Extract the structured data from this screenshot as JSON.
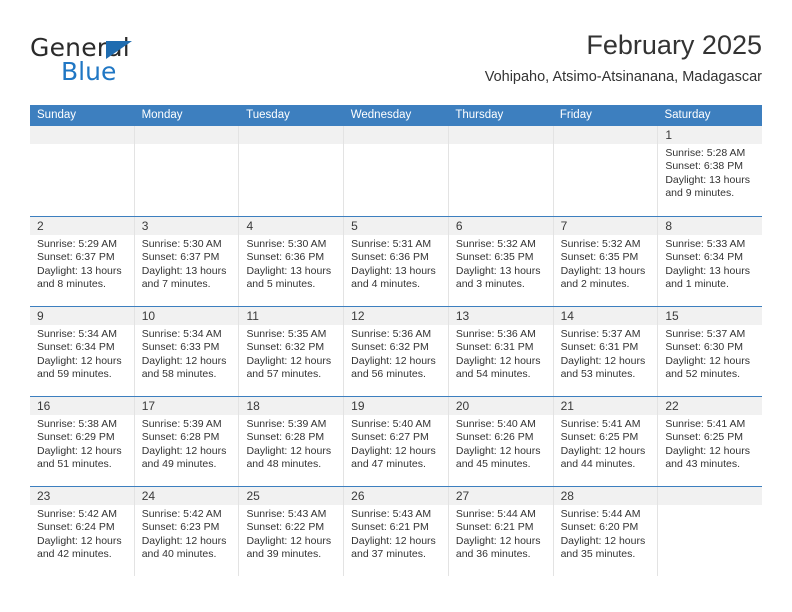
{
  "logo": {
    "word_top": "General",
    "word_bottom": "Blue",
    "triangle_color": "#1f6cb0",
    "blue_color": "#2077c4"
  },
  "header": {
    "title": "February 2025",
    "subtitle": "Vohipaho, Atsimo-Atsinanana, Madagascar"
  },
  "theme": {
    "header_bar": "#3d7fbf",
    "daynum_strip": "#f1f1f1",
    "row_divider": "#3d7fbf",
    "cell_divider": "#e3e3e3"
  },
  "weekdays": [
    "Sunday",
    "Monday",
    "Tuesday",
    "Wednesday",
    "Thursday",
    "Friday",
    "Saturday"
  ],
  "weeks": [
    [
      {
        "day": ""
      },
      {
        "day": ""
      },
      {
        "day": ""
      },
      {
        "day": ""
      },
      {
        "day": ""
      },
      {
        "day": ""
      },
      {
        "day": "1",
        "sunrise": "Sunrise: 5:28 AM",
        "sunset": "Sunset: 6:38 PM",
        "daylight": "Daylight: 13 hours and 9 minutes."
      }
    ],
    [
      {
        "day": "2",
        "sunrise": "Sunrise: 5:29 AM",
        "sunset": "Sunset: 6:37 PM",
        "daylight": "Daylight: 13 hours and 8 minutes."
      },
      {
        "day": "3",
        "sunrise": "Sunrise: 5:30 AM",
        "sunset": "Sunset: 6:37 PM",
        "daylight": "Daylight: 13 hours and 7 minutes."
      },
      {
        "day": "4",
        "sunrise": "Sunrise: 5:30 AM",
        "sunset": "Sunset: 6:36 PM",
        "daylight": "Daylight: 13 hours and 5 minutes."
      },
      {
        "day": "5",
        "sunrise": "Sunrise: 5:31 AM",
        "sunset": "Sunset: 6:36 PM",
        "daylight": "Daylight: 13 hours and 4 minutes."
      },
      {
        "day": "6",
        "sunrise": "Sunrise: 5:32 AM",
        "sunset": "Sunset: 6:35 PM",
        "daylight": "Daylight: 13 hours and 3 minutes."
      },
      {
        "day": "7",
        "sunrise": "Sunrise: 5:32 AM",
        "sunset": "Sunset: 6:35 PM",
        "daylight": "Daylight: 13 hours and 2 minutes."
      },
      {
        "day": "8",
        "sunrise": "Sunrise: 5:33 AM",
        "sunset": "Sunset: 6:34 PM",
        "daylight": "Daylight: 13 hours and 1 minute."
      }
    ],
    [
      {
        "day": "9",
        "sunrise": "Sunrise: 5:34 AM",
        "sunset": "Sunset: 6:34 PM",
        "daylight": "Daylight: 12 hours and 59 minutes."
      },
      {
        "day": "10",
        "sunrise": "Sunrise: 5:34 AM",
        "sunset": "Sunset: 6:33 PM",
        "daylight": "Daylight: 12 hours and 58 minutes."
      },
      {
        "day": "11",
        "sunrise": "Sunrise: 5:35 AM",
        "sunset": "Sunset: 6:32 PM",
        "daylight": "Daylight: 12 hours and 57 minutes."
      },
      {
        "day": "12",
        "sunrise": "Sunrise: 5:36 AM",
        "sunset": "Sunset: 6:32 PM",
        "daylight": "Daylight: 12 hours and 56 minutes."
      },
      {
        "day": "13",
        "sunrise": "Sunrise: 5:36 AM",
        "sunset": "Sunset: 6:31 PM",
        "daylight": "Daylight: 12 hours and 54 minutes."
      },
      {
        "day": "14",
        "sunrise": "Sunrise: 5:37 AM",
        "sunset": "Sunset: 6:31 PM",
        "daylight": "Daylight: 12 hours and 53 minutes."
      },
      {
        "day": "15",
        "sunrise": "Sunrise: 5:37 AM",
        "sunset": "Sunset: 6:30 PM",
        "daylight": "Daylight: 12 hours and 52 minutes."
      }
    ],
    [
      {
        "day": "16",
        "sunrise": "Sunrise: 5:38 AM",
        "sunset": "Sunset: 6:29 PM",
        "daylight": "Daylight: 12 hours and 51 minutes."
      },
      {
        "day": "17",
        "sunrise": "Sunrise: 5:39 AM",
        "sunset": "Sunset: 6:28 PM",
        "daylight": "Daylight: 12 hours and 49 minutes."
      },
      {
        "day": "18",
        "sunrise": "Sunrise: 5:39 AM",
        "sunset": "Sunset: 6:28 PM",
        "daylight": "Daylight: 12 hours and 48 minutes."
      },
      {
        "day": "19",
        "sunrise": "Sunrise: 5:40 AM",
        "sunset": "Sunset: 6:27 PM",
        "daylight": "Daylight: 12 hours and 47 minutes."
      },
      {
        "day": "20",
        "sunrise": "Sunrise: 5:40 AM",
        "sunset": "Sunset: 6:26 PM",
        "daylight": "Daylight: 12 hours and 45 minutes."
      },
      {
        "day": "21",
        "sunrise": "Sunrise: 5:41 AM",
        "sunset": "Sunset: 6:25 PM",
        "daylight": "Daylight: 12 hours and 44 minutes."
      },
      {
        "day": "22",
        "sunrise": "Sunrise: 5:41 AM",
        "sunset": "Sunset: 6:25 PM",
        "daylight": "Daylight: 12 hours and 43 minutes."
      }
    ],
    [
      {
        "day": "23",
        "sunrise": "Sunrise: 5:42 AM",
        "sunset": "Sunset: 6:24 PM",
        "daylight": "Daylight: 12 hours and 42 minutes."
      },
      {
        "day": "24",
        "sunrise": "Sunrise: 5:42 AM",
        "sunset": "Sunset: 6:23 PM",
        "daylight": "Daylight: 12 hours and 40 minutes."
      },
      {
        "day": "25",
        "sunrise": "Sunrise: 5:43 AM",
        "sunset": "Sunset: 6:22 PM",
        "daylight": "Daylight: 12 hours and 39 minutes."
      },
      {
        "day": "26",
        "sunrise": "Sunrise: 5:43 AM",
        "sunset": "Sunset: 6:21 PM",
        "daylight": "Daylight: 12 hours and 37 minutes."
      },
      {
        "day": "27",
        "sunrise": "Sunrise: 5:44 AM",
        "sunset": "Sunset: 6:21 PM",
        "daylight": "Daylight: 12 hours and 36 minutes."
      },
      {
        "day": "28",
        "sunrise": "Sunrise: 5:44 AM",
        "sunset": "Sunset: 6:20 PM",
        "daylight": "Daylight: 12 hours and 35 minutes."
      },
      {
        "day": ""
      }
    ]
  ]
}
